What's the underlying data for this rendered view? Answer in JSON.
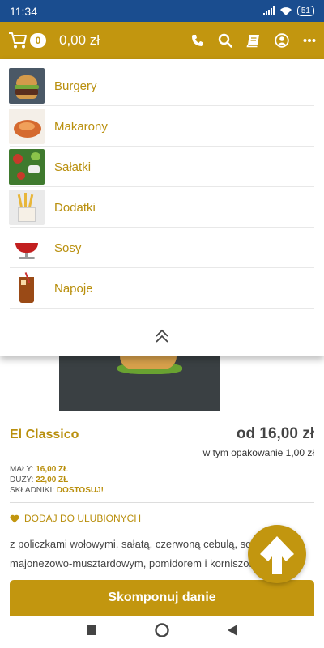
{
  "status": {
    "time": "11:34",
    "battery": "51"
  },
  "header": {
    "cart_count": "0",
    "cart_total": "0,00 zł"
  },
  "menu": {
    "items": [
      {
        "label": "Burgery",
        "icon": "burger-thumbnail"
      },
      {
        "label": "Makarony",
        "icon": "pasta-thumbnail"
      },
      {
        "label": "Sałatki",
        "icon": "salad-thumbnail"
      },
      {
        "label": "Dodatki",
        "icon": "fries-thumbnail"
      },
      {
        "label": "Sosy",
        "icon": "sauce-thumbnail"
      },
      {
        "label": "Napoje",
        "icon": "drink-thumbnail"
      }
    ]
  },
  "product": {
    "name": "El Classico",
    "price": "od 16,00 zł",
    "packaging": "w tym opakowanie 1,00 zł",
    "sizes": [
      {
        "label": "MAŁY:",
        "value": "16,00 ZŁ"
      },
      {
        "label": "DUŻY:",
        "value": "22,00 ZŁ"
      }
    ],
    "ingredients_label": "SKŁADNIKI:",
    "ingredients_value": "DOSTOSUJ!",
    "favorite_label": "DODAJ DO ULUBIONYCH",
    "description_line1": "z policzkami wołowymi, sałatą, czerwoną cebulą, sosem",
    "description_line2": "majonezowo-musztardowym, pomidorem i korniszonem",
    "compose_label": "Skomponuj danie"
  },
  "colors": {
    "brand": "#c2960f",
    "status_bar": "#1a4d8f"
  }
}
